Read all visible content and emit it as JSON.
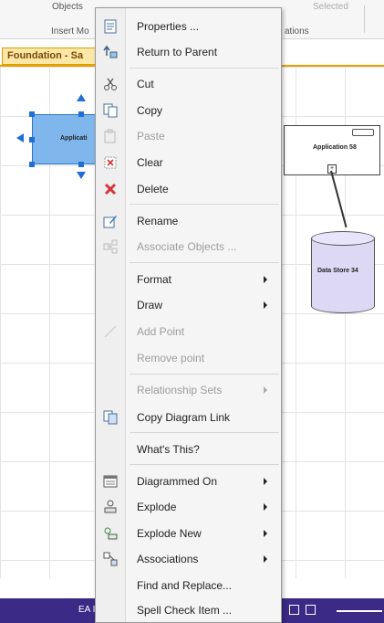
{
  "ribbon": {
    "objects_label": "Objects",
    "insert_label": "Insert Mo",
    "selected_label": "Selected",
    "relations_label": "ations"
  },
  "diagram": {
    "tab_title": "Foundation - Sa",
    "selected_element_label": "Applicati",
    "element_label": "Application 58",
    "datastore_label": "Data Store 34"
  },
  "statusbar": {
    "label": "EA I"
  },
  "menu": {
    "items": [
      {
        "label": "Properties ...",
        "icon": "properties-icon"
      },
      {
        "label": "Return to Parent",
        "icon": "return-parent-icon"
      },
      {
        "label": "Cut",
        "icon": "scissors-icon"
      },
      {
        "label": "Copy",
        "icon": "copy-icon"
      },
      {
        "label": "Paste",
        "icon": "paste-icon"
      },
      {
        "label": "Clear",
        "icon": "clear-icon"
      },
      {
        "label": "Delete",
        "icon": "delete-x-icon"
      },
      {
        "label": "Rename",
        "icon": "rename-icon"
      },
      {
        "label": "Associate Objects ...",
        "icon": "associate-icon"
      },
      {
        "label": "Format"
      },
      {
        "label": "Draw"
      },
      {
        "label": "Add Point",
        "icon": "line-icon"
      },
      {
        "label": "Remove point"
      },
      {
        "label": "Relationship Sets"
      },
      {
        "label": "Copy Diagram Link",
        "icon": "copy-link-icon"
      },
      {
        "label": "What's This?"
      },
      {
        "label": "Diagrammed On",
        "icon": "diagram-icon"
      },
      {
        "label": "Explode",
        "icon": "explode-icon"
      },
      {
        "label": "Explode New",
        "icon": "explode-new-icon"
      },
      {
        "label": "Associations",
        "icon": "associations-icon"
      },
      {
        "label": "Find and Replace..."
      },
      {
        "label": "Spell Check Item ..."
      }
    ]
  }
}
